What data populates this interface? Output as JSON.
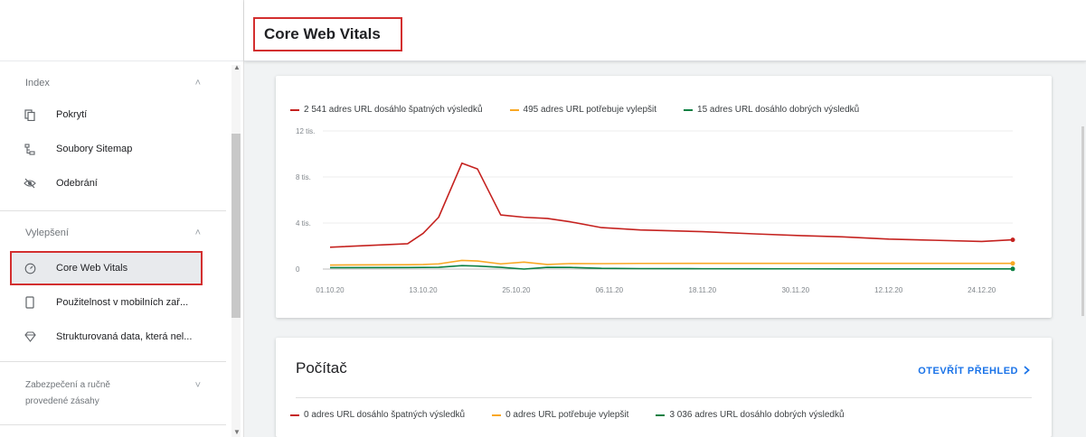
{
  "header": {
    "title": "Core Web Vitals"
  },
  "sidebar": {
    "index_label": "Index",
    "index_items": [
      {
        "label": "Pokrytí",
        "icon": "file-copy-icon"
      },
      {
        "label": "Soubory Sitemap",
        "icon": "sitemap-icon"
      },
      {
        "label": "Odebrání",
        "icon": "visibility-off-icon"
      }
    ],
    "enhancements_label": "Vylepšení",
    "enhancement_items": [
      {
        "label": "Core Web Vitals",
        "icon": "speed-icon"
      },
      {
        "label": "Použitelnost v mobilních zař...",
        "icon": "phone-icon"
      },
      {
        "label": "Strukturovaná data, která nel...",
        "icon": "diamond-icon"
      }
    ],
    "security_label_line1": "Zabezpečení a ručně",
    "security_label_line2": "provedené zásahy"
  },
  "mobile_card": {
    "legend": [
      {
        "label": "2 541 adres URL dosáhlo špatných výsledků",
        "color": "#c5221f"
      },
      {
        "label": "495 adres URL potřebuje vylepšit",
        "color": "#f9a825"
      },
      {
        "label": "15 adres URL dosáhlo dobrých výsledků",
        "color": "#0b8043"
      }
    ]
  },
  "desktop_card": {
    "title": "Počítač",
    "open_report": "OTEVŘÍT PŘEHLED",
    "open_report_icon": "chevron-right-icon",
    "legend": [
      {
        "label": "0 adres URL dosáhlo špatných výsledků",
        "color": "#c5221f"
      },
      {
        "label": "0 adres URL potřebuje vylepšit",
        "color": "#f9a825"
      },
      {
        "label": "3 036 adres URL dosáhlo dobrých výsledků",
        "color": "#0b8043"
      }
    ]
  },
  "chart_data": {
    "type": "line",
    "ylabels": [
      "12 tis.",
      "8 tis.",
      "4 tis.",
      "0"
    ],
    "yticks": [
      12000,
      8000,
      4000,
      0
    ],
    "ylim": [
      0,
      12000
    ],
    "xlabels": [
      "01.10.20",
      "13.10.20",
      "25.10.20",
      "06.11.20",
      "18.11.20",
      "30.11.20",
      "12.12.20",
      "24.12.20"
    ],
    "x": [
      "2020-10-01",
      "2020-10-11",
      "2020-10-13",
      "2020-10-15",
      "2020-10-18",
      "2020-10-20",
      "2020-10-23",
      "2020-10-26",
      "2020-10-29",
      "2020-11-01",
      "2020-11-05",
      "2020-11-10",
      "2020-11-18",
      "2020-11-25",
      "2020-12-01",
      "2020-12-06",
      "2020-12-12",
      "2020-12-18",
      "2020-12-24",
      "2020-12-28"
    ],
    "series": [
      {
        "name": "2 541 adres URL dosáhlo špatných výsledků",
        "color": "#c5221f",
        "values": [
          1900,
          2200,
          3100,
          4500,
          9200,
          8700,
          4700,
          4500,
          4400,
          4100,
          3600,
          3400,
          3250,
          3050,
          2900,
          2800,
          2600,
          2500,
          2400,
          2541
        ]
      },
      {
        "name": "495 adres URL potřebuje vylepšit",
        "color": "#f9a825",
        "values": [
          350,
          380,
          400,
          450,
          750,
          700,
          450,
          600,
          400,
          480,
          470,
          490,
          495,
          495,
          495,
          495,
          495,
          495,
          495,
          495
        ]
      },
      {
        "name": "15 adres URL dosáhlo dobrých výsledků",
        "color": "#0b8043",
        "values": [
          120,
          130,
          140,
          150,
          300,
          260,
          150,
          0,
          150,
          140,
          60,
          40,
          30,
          25,
          20,
          18,
          16,
          15,
          15,
          15
        ]
      }
    ]
  }
}
